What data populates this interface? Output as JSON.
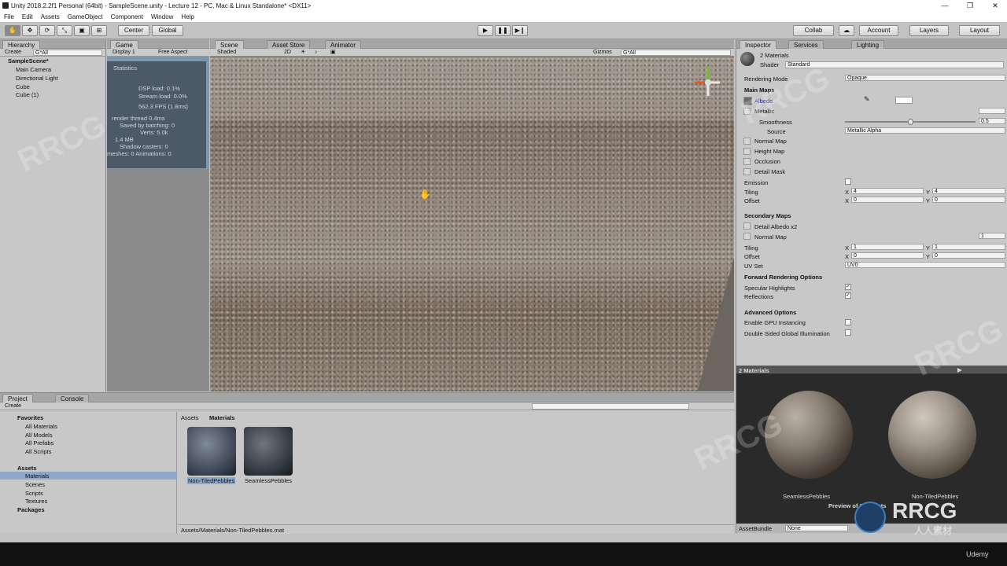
{
  "window": {
    "title": "Unity 2018.2.2f1 Personal (64bit) - SampleScene.unity - Lecture 12 - PC, Mac & Linux Standalone* <DX11>"
  },
  "menu": [
    "File",
    "Edit",
    "Assets",
    "GameObject",
    "Component",
    "Window",
    "Help"
  ],
  "toolbar": {
    "center": "Center",
    "global": "Global",
    "collab": "Collab",
    "account": "Account",
    "layers": "Layers",
    "layout": "Layout"
  },
  "hierarchy": {
    "tab": "Hierarchy",
    "create": "Create",
    "search": "G*All",
    "scene": "SampleScene*",
    "items": [
      "Main Camera",
      "Directional Light",
      "Cube",
      "Cube (1)"
    ]
  },
  "game": {
    "tab": "Game",
    "display": "Display 1",
    "aspect": "Free Aspect",
    "stats": {
      "title": "Statistics",
      "lines": [
        "DSP load: 0.1%",
        "Stream load: 0.0%",
        "562.3 FPS (1.8ms)",
        "render thread 0.4ms",
        "Saved by batching: 0",
        "Verts: 5.0k",
        "1.4 MB",
        "Shadow casters: 0",
        "meshes: 0  Animations: 0"
      ]
    }
  },
  "scene": {
    "tabs": [
      "Scene",
      "Asset Store",
      "Animator"
    ],
    "shaded": "Shaded",
    "mode2d": "2D",
    "gizmos": "Gizmos",
    "search": "G*All"
  },
  "inspector": {
    "tabs": [
      "Inspector",
      "Services",
      "Lighting"
    ],
    "name": "2 Materials",
    "shader_label": "Shader",
    "shader": "Standard",
    "rendering_mode_label": "Rendering Mode",
    "rendering_mode": "Opaque",
    "main_maps": "Main Maps",
    "albedo": "Albedo",
    "metallic": "Metallic",
    "smoothness": "Smoothness",
    "smoothness_value": "0.5",
    "smoothness_fraction": 0.5,
    "source": "Source",
    "source_value": "Metallic Alpha",
    "normal_map": "Normal Map",
    "height_map": "Height Map",
    "occlusion": "Occlusion",
    "detail_mask": "Detail Mask",
    "emission": "Emission",
    "tiling": "Tiling",
    "offset": "Offset",
    "x": "X",
    "y": "Y",
    "main_tiling": [
      "4",
      "4"
    ],
    "main_offset": [
      "0",
      "0"
    ],
    "secondary_maps": "Secondary Maps",
    "detail_albedo": "Detail Albedo x2",
    "normal_map2": "Normal Map",
    "normal_scale": "1",
    "sec_tiling": [
      "1",
      "1"
    ],
    "sec_offset": [
      "0",
      "0"
    ],
    "uvset": "UV Set",
    "uvset_value": "UV0",
    "forward": "Forward Rendering Options",
    "specular": "Specular Highlights",
    "reflections": "Reflections",
    "advanced": "Advanced Options",
    "gpu_instancing": "Enable GPU Instancing",
    "double_sided": "Double Sided Global Illumination"
  },
  "preview": {
    "title": "2 Materials",
    "left": "SeamlessPebbles",
    "right": "Non-TiledPebbles",
    "caption": "Preview of 2 Objects",
    "assetbundle": "AssetBundle",
    "ab_value": "None"
  },
  "project": {
    "tabs": [
      "Project",
      "Console"
    ],
    "create": "Create",
    "favorites": "Favorites",
    "fav_items": [
      "All Materials",
      "All Models",
      "All Prefabs",
      "All Scripts"
    ],
    "assets": "Assets",
    "asset_items": [
      "Materials",
      "Scenes",
      "Scripts",
      "Textures"
    ],
    "packages": "Packages",
    "breadcrumb": [
      "Assets",
      "Materials"
    ],
    "files": [
      "Non-TiledPebbles",
      "SeamlessPebbles"
    ],
    "status": "Assets/Materials/Non-TiledPebbles.mat"
  },
  "branding": {
    "logo_text": "RRCG",
    "logo_sub": "人人素材",
    "udemy": "Udemy"
  },
  "colors": {
    "panel": "#c2c2c2",
    "header": "#a5a5a5",
    "selection": "#8fa7c6",
    "dark": "#1e1e1e"
  }
}
